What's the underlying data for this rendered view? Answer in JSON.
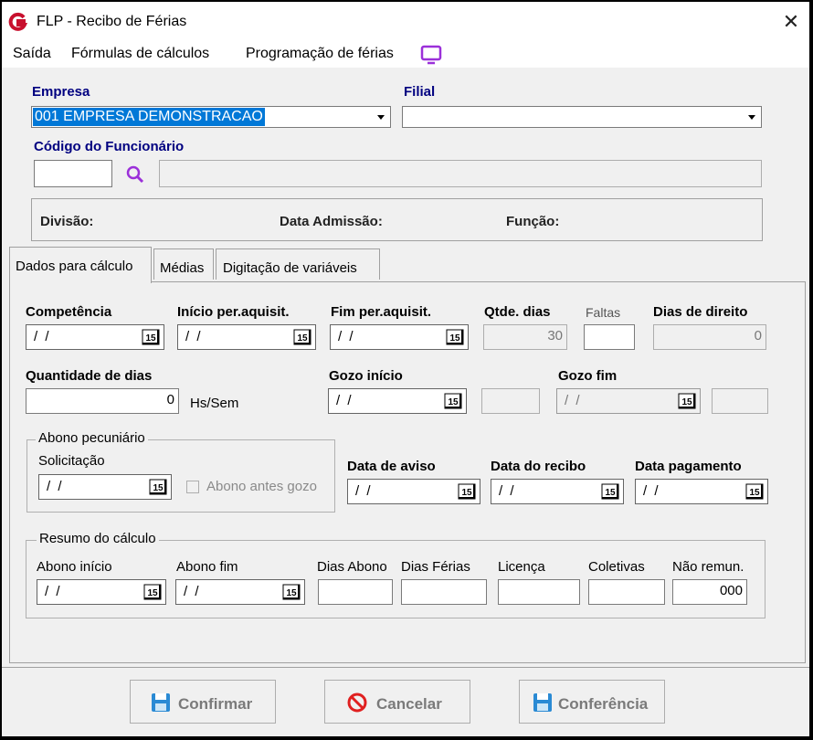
{
  "window": {
    "title": "FLP - Recibo de Férias",
    "close_glyph": "✕"
  },
  "menu": {
    "items": [
      "Saída",
      "Fórmulas de cálculos",
      "Programação de férias"
    ]
  },
  "header": {
    "empresa_label": "Empresa",
    "empresa_value": "001 EMPRESA DEMONSTRACAO",
    "filial_label": "Filial",
    "filial_value": "",
    "funcionario_label": "Código do Funcionário",
    "divisao_label": "Divisão:",
    "admissao_label": "Data Admissão:",
    "funcao_label": "Função:"
  },
  "tabs": [
    "Dados para cálculo",
    "Médias",
    "Digitação de variáveis"
  ],
  "form": {
    "competencia_label": "Competência",
    "competencia_value": "/ /",
    "inicio_label": "Início per.aquisit.",
    "inicio_value": "/ /",
    "fim_label": "Fim per.aquisit.",
    "fim_value": "/ /",
    "qtde_dias_label": "Qtde. dias",
    "qtde_dias_value": "30",
    "faltas_label": "Faltas",
    "faltas_value": "",
    "dias_direito_label": "Dias de direito",
    "dias_direito_value": "0",
    "quantidade_label": "Quantidade de dias",
    "quantidade_value": "0",
    "hs_sem_label": "Hs/Sem",
    "gozo_inicio_label": "Gozo início",
    "gozo_inicio_value": "/ /",
    "gozo_fim_label": "Gozo fim",
    "gozo_fim_value": "/ /",
    "abono_group": "Abono pecuniário",
    "solicitacao_label": "Solicitação",
    "solicitacao_value": "/ /",
    "abono_antes_label": "Abono antes gozo",
    "aviso_label": "Data de aviso",
    "aviso_value": "/ /",
    "recibo_label": "Data do recibo",
    "recibo_value": "/ /",
    "pagamento_label": "Data pagamento",
    "pagamento_value": "/ /",
    "resumo_group": "Resumo do cálculo",
    "abono_inicio_label": "Abono início",
    "abono_inicio_value": "/ /",
    "abono_fim_label": "Abono fim",
    "abono_fim_value": "/ /",
    "dias_abono_label": "Dias Abono",
    "dias_ferias_label": "Dias Férias",
    "licenca_label": "Licença",
    "coletivas_label": "Coletivas",
    "nao_remun_label": "Não remun.",
    "nao_remun_value": "000",
    "calendar_label": "15"
  },
  "buttons": {
    "confirmar": "Confirmar",
    "cancelar": "Cancelar",
    "conferencia": "Conferência"
  },
  "colors": {
    "label_blue": "#000080",
    "selection": "#0078d7",
    "logo_red": "#c8102e",
    "search_purple": "#9b30d9",
    "cancel_red": "#e02020",
    "disk_blue": "#2a8ad4"
  }
}
